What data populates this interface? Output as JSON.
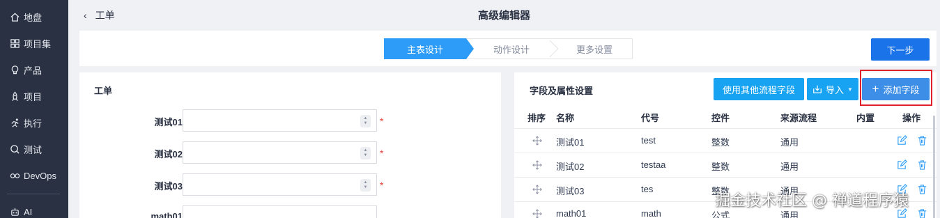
{
  "sidebar": {
    "items": [
      {
        "label": "地盘",
        "icon": "home-icon"
      },
      {
        "label": "项目集",
        "icon": "grid-icon"
      },
      {
        "label": "产品",
        "icon": "lightbulb-icon"
      },
      {
        "label": "项目",
        "icon": "rocket-icon"
      },
      {
        "label": "执行",
        "icon": "run-icon"
      },
      {
        "label": "测试",
        "icon": "search-icon"
      },
      {
        "label": "DevOps",
        "icon": "infinity-icon"
      },
      {
        "label": "AI",
        "icon": "robot-icon"
      }
    ]
  },
  "header": {
    "back_label": "工单",
    "title": "高级编辑器"
  },
  "steps": {
    "items": [
      "主表设计",
      "动作设计",
      "更多设置"
    ],
    "active_index": 0,
    "next_label": "下一步"
  },
  "form": {
    "title": "工单",
    "fields": [
      {
        "label": "测试01",
        "value": "",
        "required": "*"
      },
      {
        "label": "测试02",
        "value": "",
        "required": "*"
      },
      {
        "label": "测试03",
        "value": "",
        "required": "*"
      },
      {
        "label": "math01",
        "value": "",
        "required": ""
      }
    ]
  },
  "fields_panel": {
    "title": "字段及属性设置",
    "use_other_label": "使用其他流程字段",
    "import_label": "导入",
    "add_label": "添加字段",
    "columns": [
      "排序",
      "名称",
      "代号",
      "控件",
      "来源流程",
      "内置",
      "操作"
    ],
    "rows": [
      {
        "name": "测试01",
        "code": "test",
        "control": "整数",
        "source": "通用",
        "builtin": ""
      },
      {
        "name": "测试02",
        "code": "testaa",
        "control": "整数",
        "source": "通用",
        "builtin": ""
      },
      {
        "name": "测试03",
        "code": "tes",
        "control": "整数",
        "source": "通用",
        "builtin": ""
      },
      {
        "name": "math01",
        "code": "math",
        "control": "公式",
        "source": "通用",
        "builtin": ""
      }
    ]
  },
  "watermark": "掘金技术社区 @ 禅道程序猿",
  "colors": {
    "sidebar_bg": "#2a3142",
    "step_active": "#2c9cf8",
    "primary_button": "#1a73e8",
    "info_button": "#17a3f2",
    "highlight": "#e0202a"
  }
}
